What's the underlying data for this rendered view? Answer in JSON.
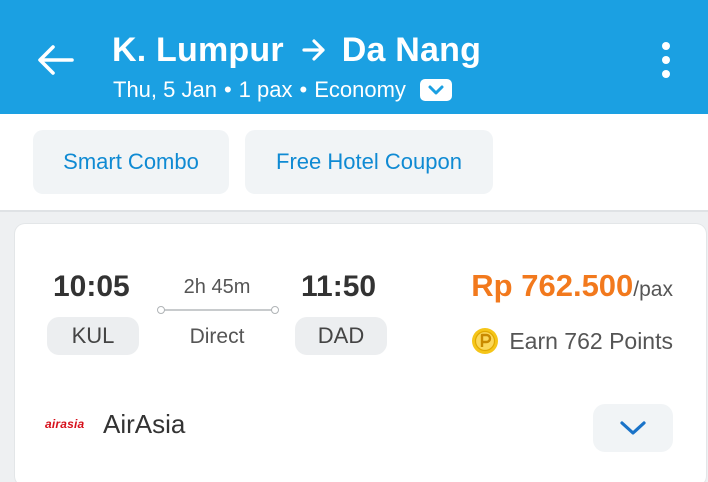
{
  "header": {
    "origin": "K. Lumpur",
    "destination": "Da Nang",
    "date": "Thu, 5 Jan",
    "pax": "1 pax",
    "cabin": "Economy",
    "separator": "•",
    "background_color": "#1ba0e2"
  },
  "icons": {
    "back": "back-arrow-icon",
    "route_arrow": "arrow-right-icon",
    "cabin_toggle": "chevron-down-icon",
    "more": "more-vertical-icon",
    "points": "points-coin-icon",
    "expand": "chevron-down-icon"
  },
  "filters": {
    "chips": [
      {
        "label": "Smart Combo"
      },
      {
        "label": "Free Hotel Coupon"
      }
    ],
    "chip_text_color": "#0f8ad3"
  },
  "flight": {
    "departure_time": "10:05",
    "departure_code": "KUL",
    "arrival_time": "11:50",
    "arrival_code": "DAD",
    "duration": "2h 45m",
    "stops": "Direct",
    "price": "Rp 762.500",
    "price_unit": "/pax",
    "price_color": "#f2791d",
    "points": "Earn 762 Points",
    "airline_logo_text": "airasia",
    "airline_name": "AirAsia"
  }
}
